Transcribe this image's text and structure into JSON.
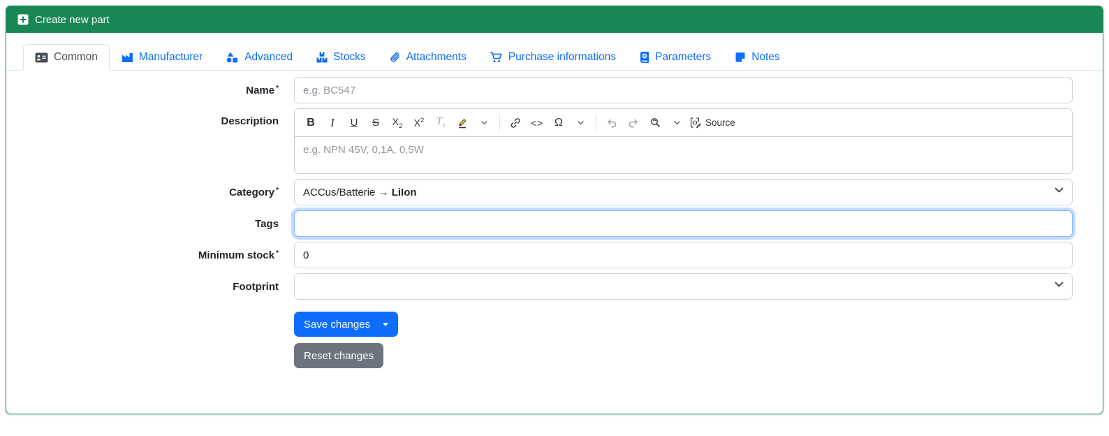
{
  "header": {
    "title": "Create new part"
  },
  "tabs": [
    {
      "label": "Common",
      "icon": "address-card-icon",
      "active": true
    },
    {
      "label": "Manufacturer",
      "icon": "industry-icon",
      "active": false
    },
    {
      "label": "Advanced",
      "icon": "shapes-icon",
      "active": false
    },
    {
      "label": "Stocks",
      "icon": "boxes-stacked-icon",
      "active": false
    },
    {
      "label": "Attachments",
      "icon": "paperclip-icon",
      "active": false
    },
    {
      "label": "Purchase informations",
      "icon": "shopping-cart-icon",
      "active": false
    },
    {
      "label": "Parameters",
      "icon": "book-atlas-icon",
      "active": false
    },
    {
      "label": "Notes",
      "icon": "sticky-note-icon",
      "active": false
    }
  ],
  "form": {
    "name": {
      "label": "Name",
      "required": "*",
      "placeholder": "e.g. BC547",
      "value": ""
    },
    "description": {
      "label": "Description",
      "placeholder": "e.g. NPN 45V, 0,1A, 0,5W"
    },
    "category": {
      "label": "Category",
      "required": "*",
      "value_prefix": "ACCus/Batterie → ",
      "value_selected": "LiIon"
    },
    "tags": {
      "label": "Tags",
      "value": ""
    },
    "min_stock": {
      "label": "Minimum stock",
      "required": "*",
      "value": "0"
    },
    "footprint": {
      "label": "Footprint",
      "value": ""
    }
  },
  "editor": {
    "toolbar": {
      "bold": "B",
      "italic": "I",
      "underline": "U",
      "strikethrough": "S",
      "sub_base": "X",
      "sub_script": "2",
      "sup_base": "X",
      "sup_script": "2",
      "removeformat_base": "T",
      "removeformat_script": "x",
      "code": "<>",
      "omega": "Ω",
      "source_label": "Source"
    }
  },
  "buttons": {
    "save": "Save changes",
    "reset": "Reset changes"
  },
  "icons": {
    "header_icon": "square-plus",
    "select_caret": "chevron-down",
    "save_caret": "caret-down"
  },
  "colors": {
    "success": "#198754",
    "primary": "#0d6efd",
    "secondary": "#6c757d",
    "tab_link": "#0d6efd",
    "highlight_pen": "#f2d22e"
  }
}
